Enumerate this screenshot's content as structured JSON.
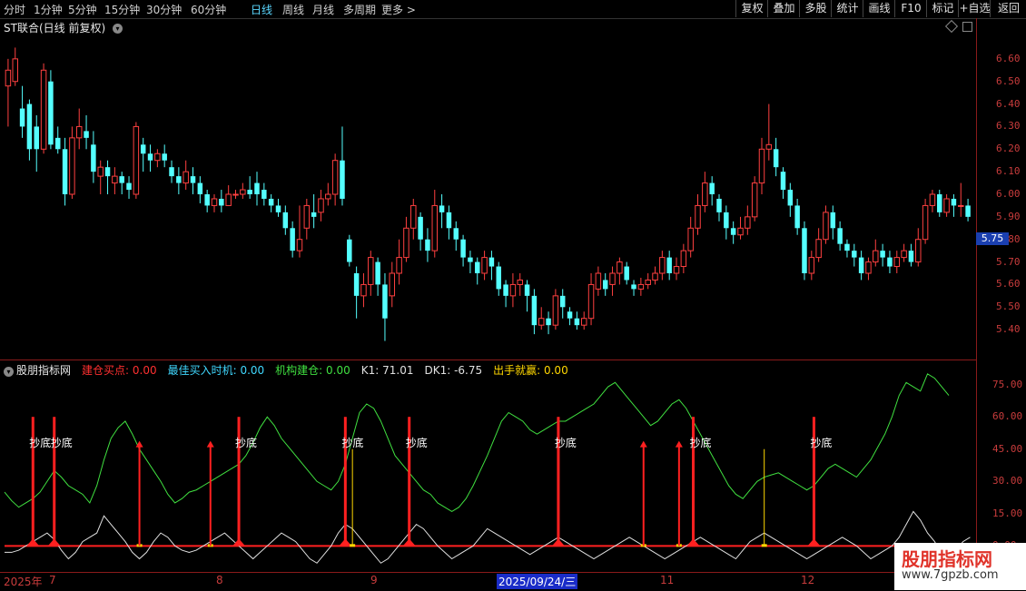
{
  "toolbar": {
    "periods": [
      "分时",
      "1分钟",
      "5分钟",
      "15分钟",
      "30分钟",
      "60分钟",
      "日线",
      "周线",
      "月线",
      "多周期",
      "更多 >"
    ],
    "active_period": "日线",
    "right_buttons": [
      "复权",
      "叠加",
      "多股",
      "统计",
      "画线",
      "F10",
      "+自选",
      "返回"
    ],
    "extra": "标记"
  },
  "chart_title": "ST联合(日线 前复权)",
  "main_axis": {
    "ticks": [
      "6.60",
      "6.50",
      "6.40",
      "6.30",
      "6.20",
      "6.10",
      "6.00",
      "5.90",
      "5.80",
      "5.70",
      "5.60",
      "5.50",
      "5.40"
    ],
    "current_price": "5.75"
  },
  "indicator": {
    "name": "股朋指标网",
    "items": [
      {
        "label": "建仓买点: 0.00",
        "color": "#ff3030"
      },
      {
        "label": "最佳买入时机: 0.00",
        "color": "#40d8ff"
      },
      {
        "label": "机构建仓: 0.00",
        "color": "#40e040"
      },
      {
        "label": "K1: 71.01",
        "color": "#e0e0e0"
      },
      {
        "label": "DK1: -6.75",
        "color": "#e0e0e0"
      },
      {
        "label": "出手就赢: 0.00",
        "color": "#ffd700"
      }
    ],
    "ticks": [
      "75.00",
      "60.00",
      "45.00",
      "30.00",
      "15.00",
      "0.00"
    ],
    "signal_text": "抄底"
  },
  "x_axis": {
    "labels": [
      "2025年",
      "7",
      "8",
      "9",
      "2025/09/24/三",
      "11",
      "12"
    ]
  },
  "watermark": {
    "title": "股朋指标网",
    "url": "www.7gpzb.com"
  },
  "chart_data": {
    "type": "candlestick",
    "price_ylim": [
      5.3,
      6.7
    ],
    "candles": [
      [
        6.48,
        6.55,
        6.3,
        6.6
      ],
      [
        6.5,
        6.6,
        6.48,
        6.65
      ],
      [
        6.38,
        6.3,
        6.25,
        6.48
      ],
      [
        6.4,
        6.2,
        6.15,
        6.42
      ],
      [
        6.3,
        6.2,
        6.1,
        6.35
      ],
      [
        6.2,
        6.55,
        6.18,
        6.58
      ],
      [
        6.5,
        6.22,
        6.2,
        6.55
      ],
      [
        6.25,
        6.2,
        6.18,
        6.3
      ],
      [
        6.2,
        6.0,
        5.95,
        6.25
      ],
      [
        6.0,
        6.25,
        5.98,
        6.3
      ],
      [
        6.25,
        6.3,
        6.2,
        6.38
      ],
      [
        6.28,
        6.25,
        6.2,
        6.35
      ],
      [
        6.22,
        6.1,
        6.05,
        6.28
      ],
      [
        6.08,
        6.12,
        6.0,
        6.15
      ],
      [
        6.12,
        6.08,
        6.0,
        6.15
      ],
      [
        6.05,
        6.08,
        6.0,
        6.12
      ],
      [
        6.08,
        6.05,
        6.0,
        6.1
      ],
      [
        6.05,
        6.02,
        5.98,
        6.08
      ],
      [
        6.0,
        6.3,
        5.98,
        6.32
      ],
      [
        6.22,
        6.18,
        6.1,
        6.25
      ],
      [
        6.18,
        6.15,
        6.1,
        6.22
      ],
      [
        6.15,
        6.18,
        6.12,
        6.2
      ],
      [
        6.18,
        6.15,
        6.12,
        6.22
      ],
      [
        6.12,
        6.08,
        6.05,
        6.15
      ],
      [
        6.08,
        6.05,
        6.0,
        6.12
      ],
      [
        6.05,
        6.1,
        6.02,
        6.15
      ],
      [
        6.08,
        6.05,
        6.0,
        6.12
      ],
      [
        6.05,
        6.0,
        5.96,
        6.08
      ],
      [
        6.0,
        5.95,
        5.92,
        6.02
      ],
      [
        5.95,
        5.98,
        5.92,
        6.0
      ],
      [
        5.98,
        5.95,
        5.92,
        6.02
      ],
      [
        5.95,
        6.0,
        5.95,
        6.04
      ],
      [
        6.0,
        6.0,
        5.98,
        6.02
      ],
      [
        6.0,
        6.02,
        5.98,
        6.05
      ],
      [
        6.02,
        6.0,
        5.98,
        6.08
      ],
      [
        6.05,
        6.0,
        5.95,
        6.1
      ],
      [
        6.02,
        5.98,
        5.95,
        6.05
      ],
      [
        5.98,
        5.95,
        5.92,
        6.0
      ],
      [
        5.95,
        5.92,
        5.9,
        5.98
      ],
      [
        5.92,
        5.85,
        5.82,
        5.95
      ],
      [
        5.85,
        5.75,
        5.72,
        5.88
      ],
      [
        5.75,
        5.8,
        5.72,
        5.95
      ],
      [
        5.85,
        5.95,
        5.8,
        5.98
      ],
      [
        5.92,
        5.9,
        5.85,
        6.0
      ],
      [
        5.92,
        5.98,
        5.88,
        6.02
      ],
      [
        5.98,
        6.0,
        5.95,
        6.05
      ],
      [
        6.0,
        6.15,
        5.95,
        6.18
      ],
      [
        6.15,
        5.98,
        5.95,
        6.3
      ],
      [
        5.8,
        5.7,
        5.68,
        5.82
      ],
      [
        5.65,
        5.55,
        5.45,
        5.68
      ],
      [
        5.55,
        5.6,
        5.5,
        5.65
      ],
      [
        5.6,
        5.72,
        5.55,
        5.75
      ],
      [
        5.7,
        5.6,
        5.55,
        5.72
      ],
      [
        5.6,
        5.45,
        5.35,
        5.65
      ],
      [
        5.55,
        5.65,
        5.5,
        5.7
      ],
      [
        5.65,
        5.72,
        5.6,
        5.8
      ],
      [
        5.72,
        5.85,
        5.7,
        5.9
      ],
      [
        5.85,
        5.95,
        5.8,
        5.98
      ],
      [
        5.9,
        5.8,
        5.75,
        5.92
      ],
      [
        5.8,
        5.75,
        5.7,
        5.85
      ],
      [
        5.75,
        5.95,
        5.72,
        6.02
      ],
      [
        5.95,
        5.92,
        5.85,
        6.0
      ],
      [
        5.92,
        5.85,
        5.8,
        5.95
      ],
      [
        5.85,
        5.8,
        5.75,
        5.88
      ],
      [
        5.8,
        5.72,
        5.68,
        5.82
      ],
      [
        5.72,
        5.7,
        5.65,
        5.75
      ],
      [
        5.7,
        5.65,
        5.6,
        5.72
      ],
      [
        5.65,
        5.72,
        5.62,
        5.75
      ],
      [
        5.72,
        5.68,
        5.62,
        5.75
      ],
      [
        5.68,
        5.58,
        5.55,
        5.7
      ],
      [
        5.6,
        5.55,
        5.5,
        5.62
      ],
      [
        5.55,
        5.6,
        5.5,
        5.65
      ],
      [
        5.6,
        5.62,
        5.55,
        5.65
      ],
      [
        5.6,
        5.55,
        5.48,
        5.62
      ],
      [
        5.55,
        5.42,
        5.38,
        5.58
      ],
      [
        5.42,
        5.45,
        5.4,
        5.5
      ],
      [
        5.45,
        5.42,
        5.38,
        5.48
      ],
      [
        5.42,
        5.55,
        5.4,
        5.58
      ],
      [
        5.55,
        5.5,
        5.45,
        5.58
      ],
      [
        5.48,
        5.45,
        5.42,
        5.5
      ],
      [
        5.45,
        5.42,
        5.4,
        5.48
      ],
      [
        5.42,
        5.45,
        5.4,
        5.48
      ],
      [
        5.45,
        5.6,
        5.42,
        5.65
      ],
      [
        5.58,
        5.65,
        5.55,
        5.68
      ],
      [
        5.62,
        5.58,
        5.55,
        5.65
      ],
      [
        5.6,
        5.65,
        5.55,
        5.68
      ],
      [
        5.65,
        5.7,
        5.6,
        5.72
      ],
      [
        5.68,
        5.62,
        5.6,
        5.7
      ],
      [
        5.6,
        5.58,
        5.55,
        5.62
      ],
      [
        5.58,
        5.6,
        5.55,
        5.63
      ],
      [
        5.6,
        5.62,
        5.58,
        5.65
      ],
      [
        5.62,
        5.65,
        5.6,
        5.68
      ],
      [
        5.65,
        5.72,
        5.62,
        5.75
      ],
      [
        5.72,
        5.65,
        5.62,
        5.75
      ],
      [
        5.65,
        5.68,
        5.62,
        5.72
      ],
      [
        5.68,
        5.75,
        5.65,
        5.78
      ],
      [
        5.75,
        5.85,
        5.72,
        5.9
      ],
      [
        5.85,
        5.95,
        5.82,
        6.0
      ],
      [
        5.95,
        6.05,
        5.92,
        6.1
      ],
      [
        6.05,
        6.0,
        5.95,
        6.08
      ],
      [
        5.98,
        5.92,
        5.88,
        6.0
      ],
      [
        5.92,
        5.85,
        5.8,
        5.95
      ],
      [
        5.85,
        5.82,
        5.78,
        5.88
      ],
      [
        5.82,
        5.85,
        5.8,
        5.9
      ],
      [
        5.85,
        5.9,
        5.82,
        5.95
      ],
      [
        5.9,
        6.05,
        5.88,
        6.08
      ],
      [
        6.05,
        6.2,
        6.0,
        6.25
      ],
      [
        6.2,
        6.22,
        6.15,
        6.4
      ],
      [
        6.2,
        6.12,
        6.08,
        6.25
      ],
      [
        6.1,
        6.02,
        5.98,
        6.12
      ],
      [
        6.02,
        5.95,
        5.9,
        6.05
      ],
      [
        5.95,
        5.85,
        5.82,
        5.98
      ],
      [
        5.85,
        5.65,
        5.62,
        5.88
      ],
      [
        5.65,
        5.72,
        5.62,
        5.75
      ],
      [
        5.72,
        5.8,
        5.7,
        5.85
      ],
      [
        5.8,
        5.92,
        5.78,
        5.95
      ],
      [
        5.92,
        5.85,
        5.8,
        5.95
      ],
      [
        5.85,
        5.78,
        5.75,
        5.88
      ],
      [
        5.78,
        5.75,
        5.72,
        5.8
      ],
      [
        5.75,
        5.72,
        5.68,
        5.78
      ],
      [
        5.72,
        5.65,
        5.62,
        5.75
      ],
      [
        5.65,
        5.7,
        5.62,
        5.72
      ],
      [
        5.7,
        5.75,
        5.68,
        5.8
      ],
      [
        5.75,
        5.72,
        5.68,
        5.78
      ],
      [
        5.72,
        5.68,
        5.65,
        5.75
      ],
      [
        5.68,
        5.72,
        5.65,
        5.75
      ],
      [
        5.72,
        5.75,
        5.7,
        5.78
      ],
      [
        5.75,
        5.7,
        5.68,
        5.78
      ],
      [
        5.7,
        5.8,
        5.68,
        5.85
      ],
      [
        5.8,
        5.95,
        5.78,
        5.98
      ],
      [
        5.95,
        6.0,
        5.92,
        6.02
      ],
      [
        6.0,
        5.92,
        5.9,
        6.02
      ],
      [
        5.92,
        5.98,
        5.9,
        6.0
      ],
      [
        5.98,
        5.95,
        5.9,
        6.0
      ],
      [
        5.95,
        5.95,
        5.9,
        6.05
      ],
      [
        5.95,
        5.9,
        5.88,
        5.98
      ]
    ],
    "indicator_ylim": [
      -10,
      85
    ],
    "k1": [
      25,
      21,
      18,
      20,
      22,
      25,
      30,
      35,
      32,
      28,
      26,
      24,
      20,
      28,
      40,
      50,
      55,
      58,
      52,
      45,
      40,
      35,
      30,
      24,
      20,
      22,
      25,
      26,
      28,
      30,
      32,
      34,
      36,
      38,
      42,
      48,
      55,
      60,
      56,
      50,
      46,
      42,
      38,
      34,
      30,
      28,
      26,
      30,
      38,
      50,
      62,
      66,
      64,
      58,
      50,
      42,
      38,
      34,
      30,
      26,
      24,
      20,
      18,
      16,
      18,
      22,
      28,
      35,
      42,
      50,
      58,
      62,
      60,
      58,
      54,
      52,
      54,
      56,
      58,
      58,
      60,
      62,
      64,
      66,
      70,
      74,
      76,
      72,
      68,
      64,
      60,
      56,
      58,
      62,
      66,
      68,
      64,
      58,
      52,
      46,
      40,
      34,
      28,
      24,
      22,
      26,
      30,
      32,
      33,
      34,
      32,
      30,
      28,
      26,
      28,
      32,
      36,
      38,
      36,
      34,
      32,
      36,
      40,
      46,
      52,
      60,
      70,
      76,
      74,
      72,
      80,
      78,
      74,
      70
    ],
    "dk1": [
      -3,
      -3,
      -2,
      0,
      2,
      4,
      6,
      3,
      -2,
      -6,
      -3,
      2,
      4,
      6,
      14,
      10,
      6,
      2,
      -3,
      -6,
      -3,
      2,
      6,
      4,
      0,
      -2,
      -3,
      -2,
      0,
      2,
      4,
      6,
      3,
      0,
      -3,
      -6,
      -3,
      0,
      3,
      6,
      4,
      2,
      -2,
      -6,
      -8,
      -4,
      0,
      6,
      10,
      8,
      4,
      0,
      -4,
      -8,
      -6,
      -2,
      2,
      6,
      10,
      8,
      4,
      0,
      -3,
      -6,
      -4,
      -2,
      0,
      4,
      8,
      6,
      4,
      2,
      0,
      -2,
      -4,
      -2,
      0,
      2,
      4,
      2,
      0,
      -2,
      -4,
      -6,
      -4,
      -2,
      0,
      2,
      4,
      2,
      0,
      -2,
      -4,
      -6,
      -4,
      -2,
      0,
      2,
      4,
      2,
      0,
      -2,
      -4,
      -6,
      -2,
      2,
      4,
      6,
      4,
      2,
      0,
      -2,
      -4,
      -6,
      -4,
      -2,
      0,
      2,
      4,
      2,
      0,
      -3,
      -6,
      -4,
      -2,
      0,
      4,
      10,
      16,
      12,
      6,
      2,
      -4,
      -6,
      -2,
      2,
      4
    ],
    "buy_signals": [
      4,
      7,
      33,
      48,
      57,
      78,
      97,
      114
    ],
    "yellow_spikes": [
      19,
      29,
      49,
      90,
      95,
      107
    ],
    "arrow_signals": [
      19,
      29,
      90,
      95
    ]
  }
}
